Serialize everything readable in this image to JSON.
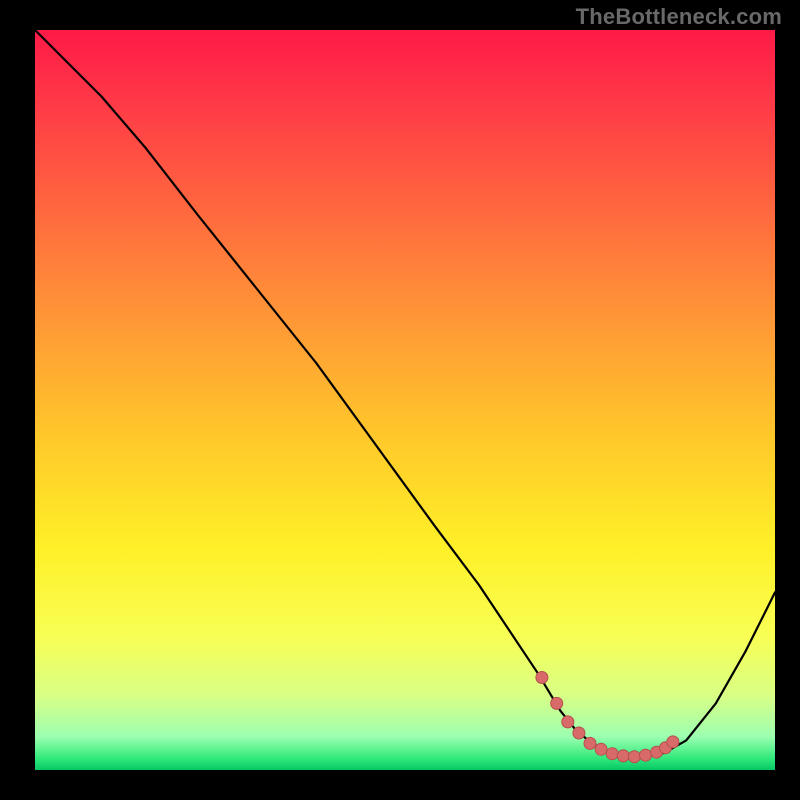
{
  "watermark": "TheBottleneck.com",
  "colors": {
    "marker_fill": "#d96a6a",
    "marker_stroke": "#b74e4e",
    "curve": "#000000"
  },
  "gradient_stops": [
    {
      "offset": 0.0,
      "color": "#ff1a47"
    },
    {
      "offset": 0.1,
      "color": "#ff3a47"
    },
    {
      "offset": 0.25,
      "color": "#ff6a3e"
    },
    {
      "offset": 0.4,
      "color": "#ff9a36"
    },
    {
      "offset": 0.55,
      "color": "#ffc82a"
    },
    {
      "offset": 0.7,
      "color": "#fff028"
    },
    {
      "offset": 0.82,
      "color": "#f8ff55"
    },
    {
      "offset": 0.9,
      "color": "#d8ff86"
    },
    {
      "offset": 0.955,
      "color": "#9cffb0"
    },
    {
      "offset": 0.985,
      "color": "#2ee87a"
    },
    {
      "offset": 1.0,
      "color": "#07c765"
    }
  ],
  "chart_data": {
    "type": "line",
    "title": "",
    "xlabel": "",
    "ylabel": "",
    "xlim": [
      0,
      100
    ],
    "ylim": [
      0,
      100
    ],
    "series": [
      {
        "name": "bottleneck-curve",
        "x": [
          0,
          4,
          9,
          15,
          22,
          30,
          38,
          46,
          54,
          60,
          64,
          68,
          71,
          73,
          75,
          77,
          79,
          81,
          83,
          85,
          88,
          92,
          96,
          100
        ],
        "y": [
          100,
          96,
          91,
          84,
          75,
          65,
          55,
          44,
          33,
          25,
          19,
          13,
          8,
          5.5,
          3.8,
          2.6,
          2.0,
          1.8,
          1.9,
          2.3,
          4.0,
          9.0,
          16,
          24
        ]
      }
    ],
    "markers": {
      "name": "optimal-range",
      "x": [
        68.5,
        70.5,
        72.0,
        73.5,
        75.0,
        76.5,
        78.0,
        79.5,
        81.0,
        82.5,
        84.0,
        85.2,
        86.2
      ],
      "y": [
        12.5,
        9.0,
        6.5,
        5.0,
        3.6,
        2.8,
        2.2,
        1.9,
        1.8,
        2.0,
        2.4,
        3.0,
        3.8
      ],
      "r": 6
    }
  }
}
